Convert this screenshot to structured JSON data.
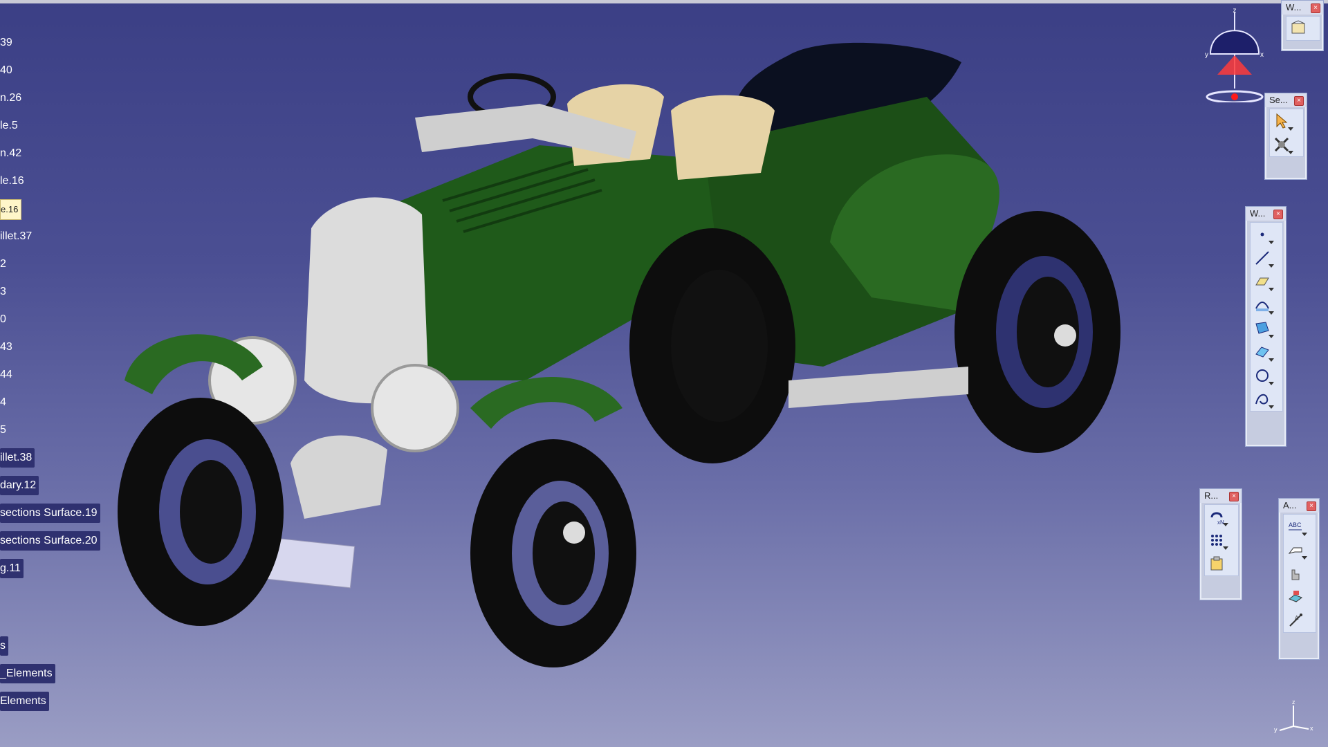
{
  "spec_tree": {
    "items": [
      {
        "label": "39",
        "style": "plain"
      },
      {
        "label": "40",
        "style": "plain"
      },
      {
        "label": "n.26",
        "style": "plain"
      },
      {
        "label": "le.5",
        "style": "plain"
      },
      {
        "label": "n.42",
        "style": "plain"
      },
      {
        "label": "le.16",
        "style": "plain"
      },
      {
        "label": "e.16",
        "style": "selected"
      },
      {
        "label": "illet.37",
        "style": "plain"
      },
      {
        "label": "2",
        "style": "plain"
      },
      {
        "label": "3",
        "style": "plain"
      },
      {
        "label": "0",
        "style": "plain"
      },
      {
        "label": "43",
        "style": "plain"
      },
      {
        "label": "44",
        "style": "plain"
      },
      {
        "label": "4",
        "style": "plain"
      },
      {
        "label": "5",
        "style": "plain"
      },
      {
        "label": "illet.38",
        "style": "boxed"
      },
      {
        "label": "dary.12",
        "style": "boxed"
      },
      {
        "label": "sections Surface.19",
        "style": "boxed"
      },
      {
        "label": "sections Surface.20",
        "style": "boxed"
      },
      {
        "label": "g.11",
        "style": "boxed"
      },
      {
        "label": "s",
        "style": "boxed"
      },
      {
        "label": "_Elements",
        "style": "boxed"
      },
      {
        "label": "Elements",
        "style": "boxed"
      }
    ]
  },
  "toolbars": {
    "view": {
      "title": "W...",
      "close": "×",
      "icons": [
        "view-mode-icon"
      ]
    },
    "select": {
      "title": "Se...",
      "close": "×",
      "icons": [
        "select-arrow-icon",
        "select-trap-icon"
      ]
    },
    "wireframe": {
      "title": "W...",
      "close": "×",
      "icons": [
        "point-icon",
        "line-icon",
        "plane-icon",
        "projection-icon",
        "intersection-icon",
        "offset-surface-icon",
        "circle-icon",
        "spline-icon"
      ]
    },
    "replication": {
      "title": "R...",
      "close": "×",
      "icons": [
        "repeat-object-icon",
        "grid-pattern-icon",
        "paste-icon"
      ]
    },
    "annotations": {
      "title": "A...",
      "close": "×",
      "icons": [
        "text-abc-icon",
        "flag-note-icon",
        "hand-annotation-icon",
        "3d-annotation-icon",
        "measure-icon"
      ]
    }
  },
  "compass": {
    "z_label": "z",
    "x_label": "x",
    "y_label": "y"
  },
  "axis": {
    "z_label": "z",
    "x_label": "x",
    "y_label": "y"
  },
  "colors": {
    "car_green": "#1f5a1a",
    "tyre": "#0d0d0d",
    "chrome": "#d9d9d9",
    "leather": "#e6d3a6",
    "hood": "#0b1020"
  }
}
